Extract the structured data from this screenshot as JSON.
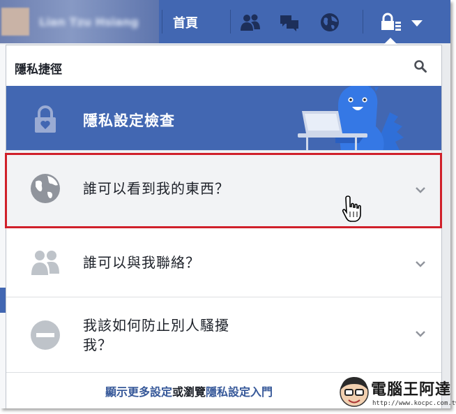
{
  "topbar": {
    "profile_name": "Lian Tzu Hsiang",
    "home_label": "首頁"
  },
  "panel": {
    "title": "隱私捷徑",
    "banner_label": "隱私設定檢查",
    "rows": [
      {
        "label": "誰可以看到我的東西？",
        "icon": "globe-icon"
      },
      {
        "label": "誰可以與我聯絡？",
        "icon": "friends-icon"
      },
      {
        "label_line1": "我該如何防止別人騷擾",
        "label_line2": "我？",
        "icon": "block-icon"
      }
    ],
    "footer": {
      "link1": "顯示更多設定",
      "connector": "或瀏覽",
      "link2": "隱私設定入門"
    }
  },
  "watermark": {
    "title": "電腦王阿達",
    "url": "http://www.kocpc.com.tw"
  },
  "colors": {
    "facebook_blue": "#4267b2",
    "link_blue": "#365899",
    "highlight_red": "#d0202a",
    "icon_grey": "#90949c"
  }
}
